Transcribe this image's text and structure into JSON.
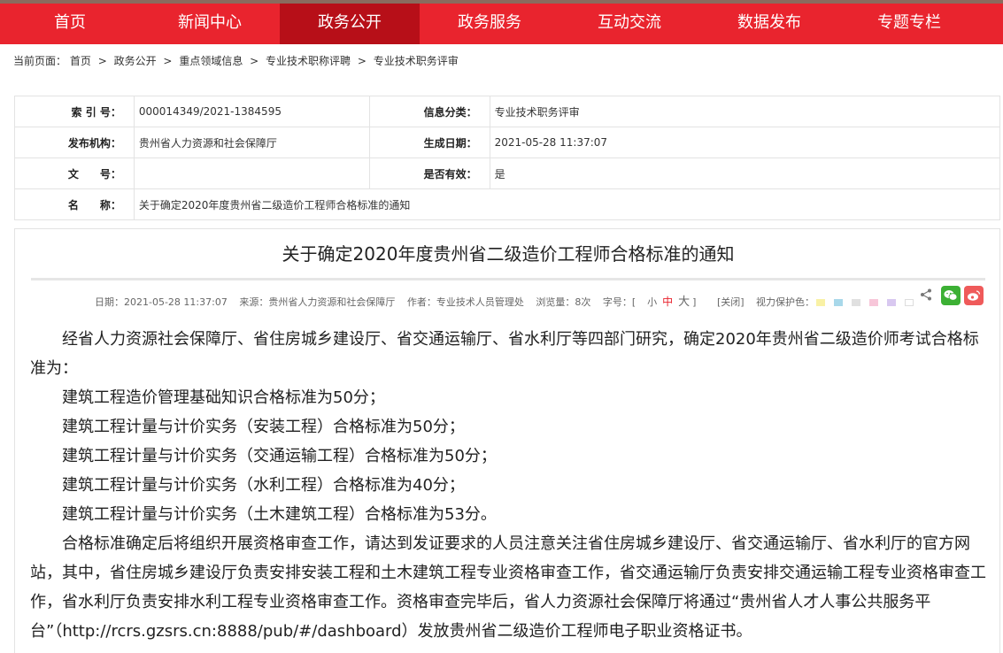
{
  "nav": [
    {
      "label": "首页",
      "active": false
    },
    {
      "label": "新闻中心",
      "active": false
    },
    {
      "label": "政务公开",
      "active": true
    },
    {
      "label": "政务服务",
      "active": false
    },
    {
      "label": "互动交流",
      "active": false
    },
    {
      "label": "数据发布",
      "active": false
    },
    {
      "label": "专题专栏",
      "active": false
    }
  ],
  "breadcrumb": {
    "prefix": "当前页面：",
    "items": [
      "首页",
      "政务公开",
      "重点领域信息",
      "专业技术职称评聘",
      "专业技术职务评审"
    ],
    "separator": ">"
  },
  "meta": {
    "index_label": "索 引 号：",
    "index_value": "000014349/2021-1384595",
    "category_label": "信息分类：",
    "category_value": "专业技术职务评审",
    "publisher_label": "发布机构：",
    "publisher_value": "贵州省人力资源和社会保障厅",
    "date_label": "生成日期：",
    "date_value": "2021-05-28 11:37:07",
    "docno_label": "文　　号：",
    "docno_value": "",
    "valid_label": "是否有效：",
    "valid_value": "是",
    "name_label": "名　　称：",
    "name_value": "关于确定2020年度贵州省二级造价工程师合格标准的通知"
  },
  "article": {
    "title": "关于确定2020年度贵州省二级造价工程师合格标准的通知",
    "date": "日期：2021-05-28 11:37:07",
    "source": "来源：贵州省人力资源和社会保障厅",
    "author": "作者：专业技术人员管理处",
    "views": "浏览量：8次",
    "font_size_label": "字号：[",
    "font_small": "小",
    "font_medium": "中",
    "font_large": "大",
    "font_size_close": "]",
    "close_label": "[关闭]",
    "eye_protect_label": "视力保护色：",
    "swatch_colors": [
      "#f9f1a5",
      "#a8d8ea",
      "#e0e0e0",
      "#f7c6d9",
      "#d8c8f0",
      "#ffffff"
    ],
    "paragraphs": [
      "经省人力资源社会保障厅、省住房城乡建设厅、省交通运输厅、省水利厅等四部门研究，确定2020年贵州省二级造价师考试合格标准为：",
      "建筑工程造价管理基础知识合格标准为50分；",
      "建筑工程计量与计价实务（安装工程）合格标准为50分；",
      "建筑工程计量与计价实务（交通运输工程）合格标准为50分；",
      "建筑工程计量与计价实务（水利工程）合格标准为40分；",
      "建筑工程计量与计价实务（土木建筑工程）合格标准为53分。",
      "合格标准确定后将组织开展资格审查工作，请达到发证要求的人员注意关注省住房城乡建设厅、省交通运输厅、省水利厅的官方网站，其中，省住房城乡建设厅负责安排安装工程和土木建筑工程专业资格审查工作，省交通运输厅负责安排交通运输工程专业资格审查工作，省水利厅负责安排水利工程专业资格审查工作。资格审查完毕后，省人力资源社会保障厅将通过“贵州省人才人事公共服务平台”（http://rcrs.gzsrs.cn:8888/pub/#/dashboard）发放贵州省二级造价工程师电子职业资格证书。"
    ]
  },
  "colors": {
    "nav_bg": "#e9242e",
    "nav_active": "#b70f18",
    "wechat": "#3cb034",
    "weibo": "#ef5a5a"
  }
}
